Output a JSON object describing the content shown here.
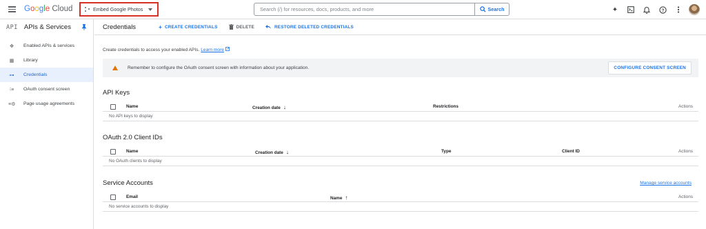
{
  "topbar": {
    "logo": {
      "google": "Google",
      "cloud": "Cloud"
    },
    "project": "Embed Google Photos",
    "search_placeholder": "Search (/) for resources, docs, products, and more",
    "search_button": "Search"
  },
  "sidebar": {
    "api_mark": "API",
    "title": "APIs & Services",
    "items": [
      {
        "label": "Enabled APIs & services",
        "icon": "hub-icon"
      },
      {
        "label": "Library",
        "icon": "library-icon"
      },
      {
        "label": "Credentials",
        "icon": "key-icon",
        "active": true
      },
      {
        "label": "OAuth consent screen",
        "icon": "consent-icon"
      },
      {
        "label": "Page usage agreements",
        "icon": "settings-list-icon"
      }
    ]
  },
  "toolbar": {
    "title": "Credentials",
    "create": "CREATE CREDENTIALS",
    "delete": "DELETE",
    "restore": "RESTORE DELETED CREDENTIALS"
  },
  "intro": {
    "text": "Create credentials to access your enabled APIs.",
    "link": "Learn more"
  },
  "warning": {
    "message": "Remember to configure the OAuth consent screen with information about your application.",
    "button": "CONFIGURE CONSENT SCREEN"
  },
  "api_keys": {
    "title": "API Keys",
    "columns": [
      "Name",
      "Creation date",
      "Restrictions",
      "Actions"
    ],
    "empty": "No API keys to display"
  },
  "oauth": {
    "title": "OAuth 2.0 Client IDs",
    "columns": [
      "Name",
      "Creation date",
      "Type",
      "Client ID",
      "Actions"
    ],
    "empty": "No OAuth clients to display"
  },
  "service_accounts": {
    "title": "Service Accounts",
    "manage_link": "Manage service accounts",
    "columns": [
      "Email",
      "Name",
      "Actions"
    ],
    "empty": "No service accounts to display"
  },
  "colors": {
    "accent": "#1a73e8",
    "warning": "#e37400",
    "highlight": "#d93025",
    "active_bg": "#e8f0fe"
  }
}
